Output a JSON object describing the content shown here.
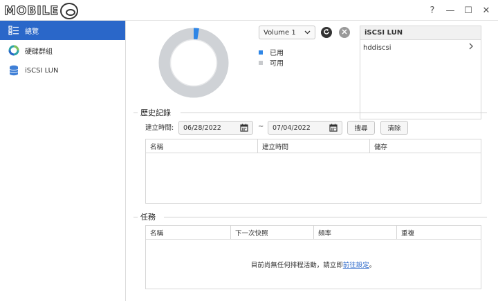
{
  "app": {
    "logo_text": "MOBILE"
  },
  "window_controls": {
    "help": "?",
    "minimize": "—",
    "maximize": "☐",
    "close": "✕"
  },
  "sidebar": {
    "items": [
      {
        "label": "總覽",
        "icon": "overview-icon",
        "active": true
      },
      {
        "label": "硬碟群組",
        "icon": "disk-group-icon",
        "active": false
      },
      {
        "label": "iSCSI LUN",
        "icon": "database-icon",
        "active": false
      }
    ]
  },
  "usage": {
    "volume_selected": "Volume 1",
    "used_fraction": 0.025,
    "used_color": "#2f86e6",
    "free_color": "#cfd2d6",
    "legend": [
      {
        "label": "已用",
        "color": "#2f86e6"
      },
      {
        "label": "可用",
        "color": "#c8cacd"
      }
    ]
  },
  "lun_panel": {
    "header": "iSCSI LUN",
    "items": [
      "hddiscsi"
    ]
  },
  "history": {
    "title": "歷史記錄",
    "date_label": "建立時間:",
    "date_from": "06/28/2022",
    "date_sep": "~",
    "date_to": "07/04/2022",
    "search_button": "搜尋",
    "clear_button": "清除",
    "columns": [
      "名稱",
      "建立時間",
      "儲存"
    ]
  },
  "tasks": {
    "title": "任務",
    "columns": [
      "名稱",
      "下一次快照",
      "頻率",
      "重複"
    ],
    "empty_prefix": "目前尚無任何排程活動，請立即",
    "empty_link": "前往設定",
    "empty_suffix": "。"
  },
  "colors": {
    "accent": "#2a67c9"
  }
}
